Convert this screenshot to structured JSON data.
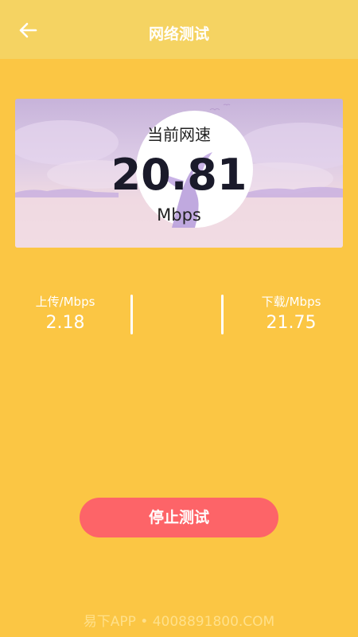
{
  "header": {
    "title": "网络测试",
    "back_icon": "arrow-left-icon"
  },
  "speed": {
    "label": "当前网速",
    "value": "20.81",
    "unit": "Mbps"
  },
  "stats": {
    "upload_label": "上传/Mbps",
    "upload_value": "2.18",
    "download_label": "下载/Mbps",
    "download_value": "21.75"
  },
  "actions": {
    "stop_label": "停止测试"
  },
  "watermark": "易下APP • 4008891800.COM",
  "colors": {
    "background": "#FBC644",
    "header": "#F5D362",
    "stop_button": "#FD6468"
  }
}
